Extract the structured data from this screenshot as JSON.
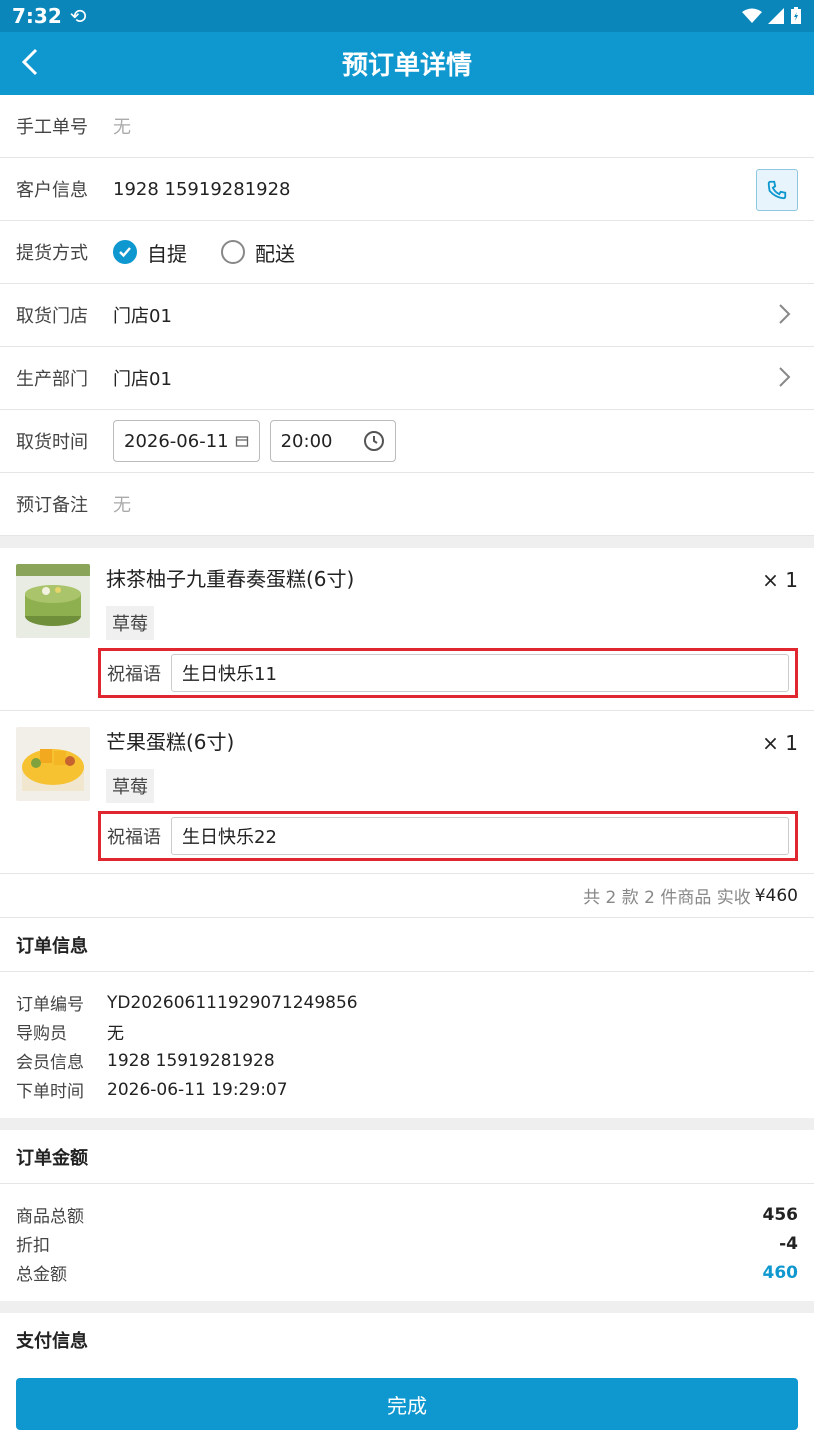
{
  "status_bar": {
    "time": "7:32"
  },
  "app_bar": {
    "title": "预订单详情"
  },
  "form": {
    "manual_no": {
      "label": "手工单号",
      "value": "无"
    },
    "customer": {
      "label": "客户信息",
      "value": "1928 15919281928"
    },
    "delivery": {
      "label": "提货方式",
      "options": [
        "自提",
        "配送"
      ],
      "selected": "自提"
    },
    "pickup_store": {
      "label": "取货门店",
      "value": "门店01"
    },
    "production": {
      "label": "生产部门",
      "value": "门店01"
    },
    "pickup_time": {
      "label": "取货时间",
      "date": "2026-06-11",
      "time": "20:00"
    },
    "remark": {
      "label": "预订备注",
      "value": "无"
    }
  },
  "products": [
    {
      "name": "抹茶柚子九重春奏蛋糕(6寸)",
      "qty": "× 1",
      "tag": "草莓",
      "bless_label": "祝福语",
      "bless_value": "生日快乐11"
    },
    {
      "name": "芒果蛋糕(6寸)",
      "qty": "× 1",
      "tag": "草莓",
      "bless_label": "祝福语",
      "bless_value": "生日快乐22"
    }
  ],
  "summary": {
    "text": "共 2 款 2 件商品 实收",
    "amount": "¥460"
  },
  "order_info": {
    "title": "订单信息",
    "rows": [
      {
        "k": "订单编号",
        "v": "YD2026061119290712498​56"
      },
      {
        "k": "导购员",
        "v": "无"
      },
      {
        "k": "会员信息",
        "v": "1928 15919281928"
      },
      {
        "k": "下单时间",
        "v": "2026-06-11 19:29:07"
      }
    ]
  },
  "order_amount": {
    "title": "订单金额",
    "rows": [
      {
        "k": "商品总额",
        "v": "456"
      },
      {
        "k": "折扣",
        "v": "-4"
      },
      {
        "k": "总金额",
        "v": "460"
      }
    ]
  },
  "payment_info": {
    "title": "支付信息"
  },
  "footer": {
    "done_label": "完成"
  },
  "colors": {
    "primary": "#0f98cf",
    "highlight": "#e0262e"
  }
}
